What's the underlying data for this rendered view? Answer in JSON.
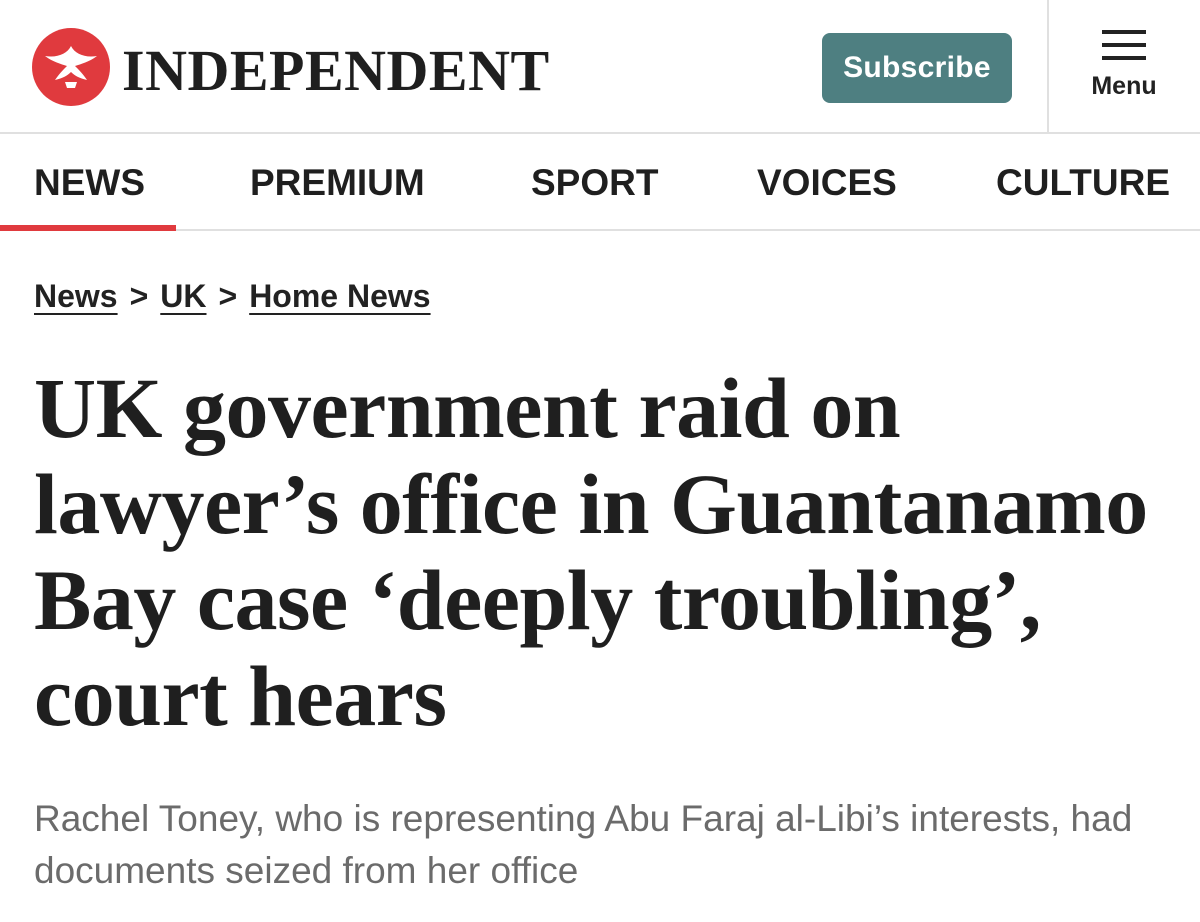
{
  "header": {
    "brand": "INDEPENDENT",
    "logo_icon": "eagle-icon",
    "subscribe_label": "Subscribe",
    "menu_label": "Menu",
    "menu_icon": "hamburger-icon"
  },
  "nav": {
    "items": [
      {
        "label": "NEWS",
        "active": true
      },
      {
        "label": "PREMIUM",
        "active": false
      },
      {
        "label": "SPORT",
        "active": false
      },
      {
        "label": "VOICES",
        "active": false
      },
      {
        "label": "CULTURE",
        "active": false
      }
    ]
  },
  "breadcrumb": {
    "items": [
      "News",
      "UK",
      "Home News"
    ],
    "separator": ">"
  },
  "article": {
    "headline": "UK government raid on lawyer’s office in Guantanamo Bay case ‘deeply troubling’, court hears",
    "standfirst": "Rachel Toney, who is representing Abu Faraj al-Libi’s interests, had documents seized from her office"
  },
  "colors": {
    "brand_red": "#e03a3e",
    "subscribe_bg": "#4e7f81",
    "text": "#1f1f1f",
    "standfirst": "#6b6b6b"
  }
}
